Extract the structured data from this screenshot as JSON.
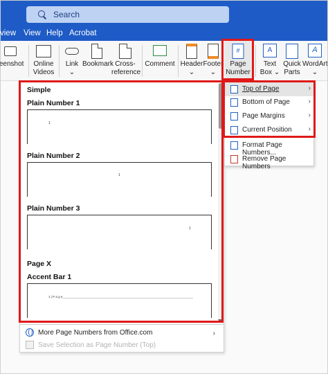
{
  "titlebar": {
    "search_placeholder": "Search"
  },
  "menubar": {
    "items": [
      "View",
      "Help",
      "Acrobat"
    ],
    "first_visible": "view"
  },
  "ribbon": {
    "screenshot": "Screenshot",
    "screenshot_visible": "reenshot",
    "online_videos_1": "Online",
    "online_videos_2": "Videos",
    "link": "Link",
    "bookmark": "Bookmark",
    "cross_ref_1": "Cross-",
    "cross_ref_2": "reference",
    "comment": "Comment",
    "header": "Header",
    "footer": "Footer",
    "page_number_1": "Page",
    "page_number_2": "Number",
    "text_box_1": "Text",
    "text_box_2": "Box",
    "quick_parts_1": "Quick",
    "quick_parts_2": "Parts",
    "wordart": "WordArt"
  },
  "gallery": {
    "section_simple": "Simple",
    "items": [
      {
        "label": "Plain Number 1",
        "number": "1"
      },
      {
        "label": "Plain Number 2",
        "number": "1"
      },
      {
        "label": "Plain Number 3",
        "number": "1"
      }
    ],
    "section_pagex": "Page X",
    "accent_bar_label": "Accent Bar 1",
    "accent_bar_text": "1 | P a g e"
  },
  "gallery_footer": {
    "more": "More Page Numbers from Office.com",
    "save": "Save Selection as Page Number (Top)"
  },
  "submenu": {
    "items": [
      "Top of Page",
      "Bottom of Page",
      "Page Margins",
      "Current Position"
    ],
    "actions": [
      "Format Page Numbers...",
      "Remove Page Numbers"
    ]
  },
  "colors": {
    "titlebar": "#1e5bc6",
    "highlight": "#e01919",
    "accent": "#1f5fc2"
  }
}
